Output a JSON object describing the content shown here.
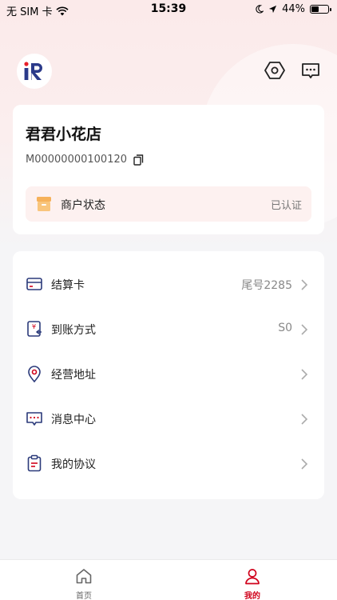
{
  "status_bar": {
    "carrier": "无 SIM 卡",
    "time": "15:39",
    "battery": "44%",
    "battery_level": 0.44
  },
  "header": {
    "settings_icon": "hexagon-settings-icon",
    "message_icon": "chat-bubble-icon"
  },
  "shop": {
    "name": "君君小花店",
    "merchant_id": "M00000000100120",
    "status_label": "商户状态",
    "status_value": "已认证"
  },
  "menu": [
    {
      "label": "结算卡",
      "value": "尾号2285",
      "icon": "bank-card-icon"
    },
    {
      "label": "到账方式",
      "value": "S0",
      "icon": "yuan-receipt-icon"
    },
    {
      "label": "经营地址",
      "value": "",
      "icon": "location-pin-icon"
    },
    {
      "label": "消息中心",
      "value": "",
      "icon": "message-icon"
    },
    {
      "label": "我的协议",
      "value": "",
      "icon": "agreement-clipboard-icon"
    }
  ],
  "tabbar": {
    "home": {
      "label": "首页",
      "color": "#666666"
    },
    "mine": {
      "label": "我的",
      "color": "#d0021b"
    }
  },
  "colors": {
    "accent": "#d0021b",
    "icon_navy": "#2b3a7a"
  }
}
